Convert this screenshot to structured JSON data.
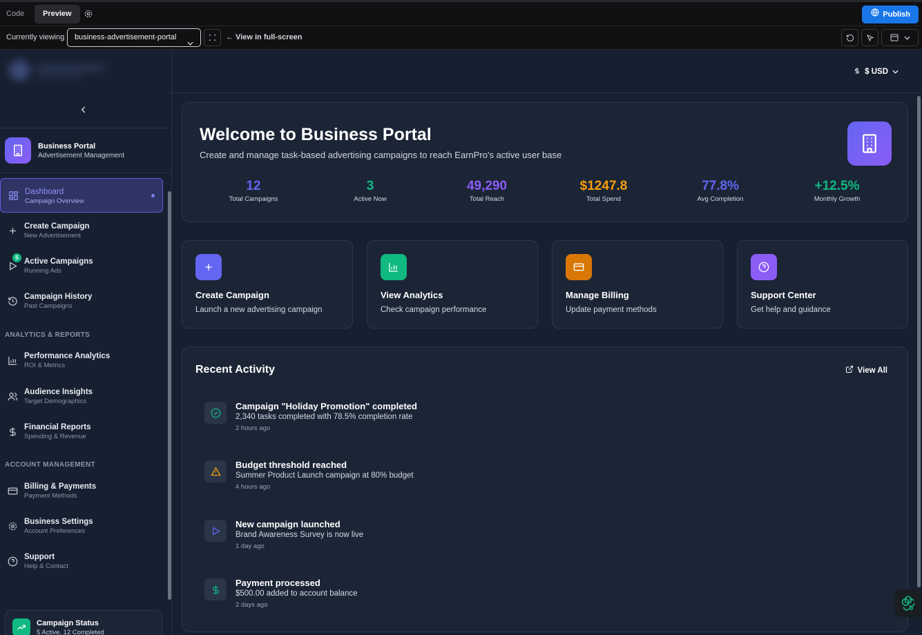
{
  "editor": {
    "tab_code": "Code",
    "tab_preview": "Preview",
    "publish_label": "Publish",
    "currently_viewing_label": "Currently viewing",
    "selected_view": "business-advertisement-portal",
    "fullscreen_label": "View in full-screen"
  },
  "sidebar": {
    "brand_title": "Business Portal",
    "brand_subtitle": "Advertisement Management",
    "items": [
      {
        "label": "Dashboard",
        "sub": "Campaign Overview",
        "icon": "grid-icon",
        "active": true
      },
      {
        "label": "Create Campaign",
        "sub": "New Advertisement",
        "icon": "plus-icon"
      },
      {
        "label": "Active Campaigns",
        "sub": "Running Ads",
        "icon": "play-icon",
        "badge": "5"
      },
      {
        "label": "Campaign History",
        "sub": "Past Campaigns",
        "icon": "history-icon"
      }
    ],
    "section_analytics": "ANALYTICS & REPORTS",
    "analytics_items": [
      {
        "label": "Performance Analytics",
        "sub": "ROI & Metrics",
        "icon": "bar-chart-icon"
      },
      {
        "label": "Audience Insights",
        "sub": "Target Demographics",
        "icon": "users-icon"
      },
      {
        "label": "Financial Reports",
        "sub": "Spending & Revenue",
        "icon": "dollar-icon"
      }
    ],
    "section_account": "ACCOUNT MANAGEMENT",
    "account_items": [
      {
        "label": "Billing & Payments",
        "sub": "Payment Methods",
        "icon": "credit-card-icon"
      },
      {
        "label": "Business Settings",
        "sub": "Account Preferences",
        "icon": "gear-icon"
      },
      {
        "label": "Support",
        "sub": "Help & Contact",
        "icon": "help-icon"
      }
    ],
    "status_title": "Campaign Status",
    "status_sub": "5 Active, 12 Completed"
  },
  "header": {
    "currency": "$ USD"
  },
  "welcome": {
    "title": "Welcome to Business Portal",
    "subtitle": "Create and manage task-based advertising campaigns to reach EarnPro's active user base",
    "stats": [
      {
        "value": "12",
        "label": "Total Campaigns",
        "color": "#6366f1"
      },
      {
        "value": "3",
        "label": "Active Now",
        "color": "#10b981"
      },
      {
        "value": "49,290",
        "label": "Total Reach",
        "color": "#8b5cf6"
      },
      {
        "value": "$1247.8",
        "label": "Total Spend",
        "color": "#f59e0b"
      },
      {
        "value": "77.8%",
        "label": "Avg Completion",
        "color": "#6366f1"
      },
      {
        "value": "+12.5%",
        "label": "Monthly Growth",
        "color": "#10b981"
      }
    ]
  },
  "quick_actions": [
    {
      "title": "Create Campaign",
      "sub": "Launch a new advertising campaign",
      "icon": "plus-icon",
      "color": "#6366f1"
    },
    {
      "title": "View Analytics",
      "sub": "Check campaign performance",
      "icon": "bar-chart-icon",
      "color": "#10b981"
    },
    {
      "title": "Manage Billing",
      "sub": "Update payment methods",
      "icon": "credit-card-icon",
      "color": "#d97706"
    },
    {
      "title": "Support Center",
      "sub": "Get help and guidance",
      "icon": "help-icon",
      "color": "#8b5cf6"
    }
  ],
  "activity": {
    "title": "Recent Activity",
    "view_all": "View All",
    "items": [
      {
        "title": "Campaign \"Holiday Promotion\" completed",
        "desc": "2,340 tasks completed with 78.5% completion rate",
        "time": "2 hours ago",
        "icon": "check-circle-icon",
        "color": "#10b981"
      },
      {
        "title": "Budget threshold reached",
        "desc": "Summer Product Launch campaign at 80% budget",
        "time": "4 hours ago",
        "icon": "warning-icon",
        "color": "#f59e0b"
      },
      {
        "title": "New campaign launched",
        "desc": "Brand Awareness Survey is now live",
        "time": "1 day ago",
        "icon": "play-icon",
        "color": "#6366f1"
      },
      {
        "title": "Payment processed",
        "desc": "$500.00 added to account balance",
        "time": "2 days ago",
        "icon": "dollar-icon",
        "color": "#10b981"
      }
    ]
  }
}
